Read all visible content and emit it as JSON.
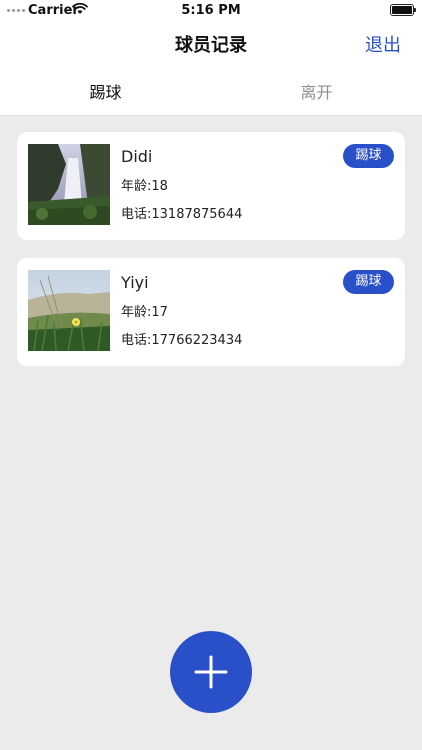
{
  "status_bar": {
    "carrier": "Carrier",
    "time": "5:16 PM"
  },
  "nav": {
    "title": "球员记录",
    "logout_label": "退出"
  },
  "tabs": [
    {
      "label": "踢球",
      "active": true
    },
    {
      "label": "离开",
      "active": false
    }
  ],
  "players": [
    {
      "name": "Didi",
      "age": "年龄:18",
      "phone": "电话:13187875644",
      "status": "踢球",
      "photo": "waterfall-photo"
    },
    {
      "name": "Yiyi",
      "age": "年龄:17",
      "phone": "电话:17766223434",
      "status": "踢球",
      "photo": "dune-flower-photo"
    }
  ],
  "fab": {
    "icon": "plus-icon"
  },
  "colors": {
    "accent": "#2a50c9",
    "background": "#ebebeb",
    "card": "#ffffff",
    "inactive_tab": "#8e8e8e"
  }
}
